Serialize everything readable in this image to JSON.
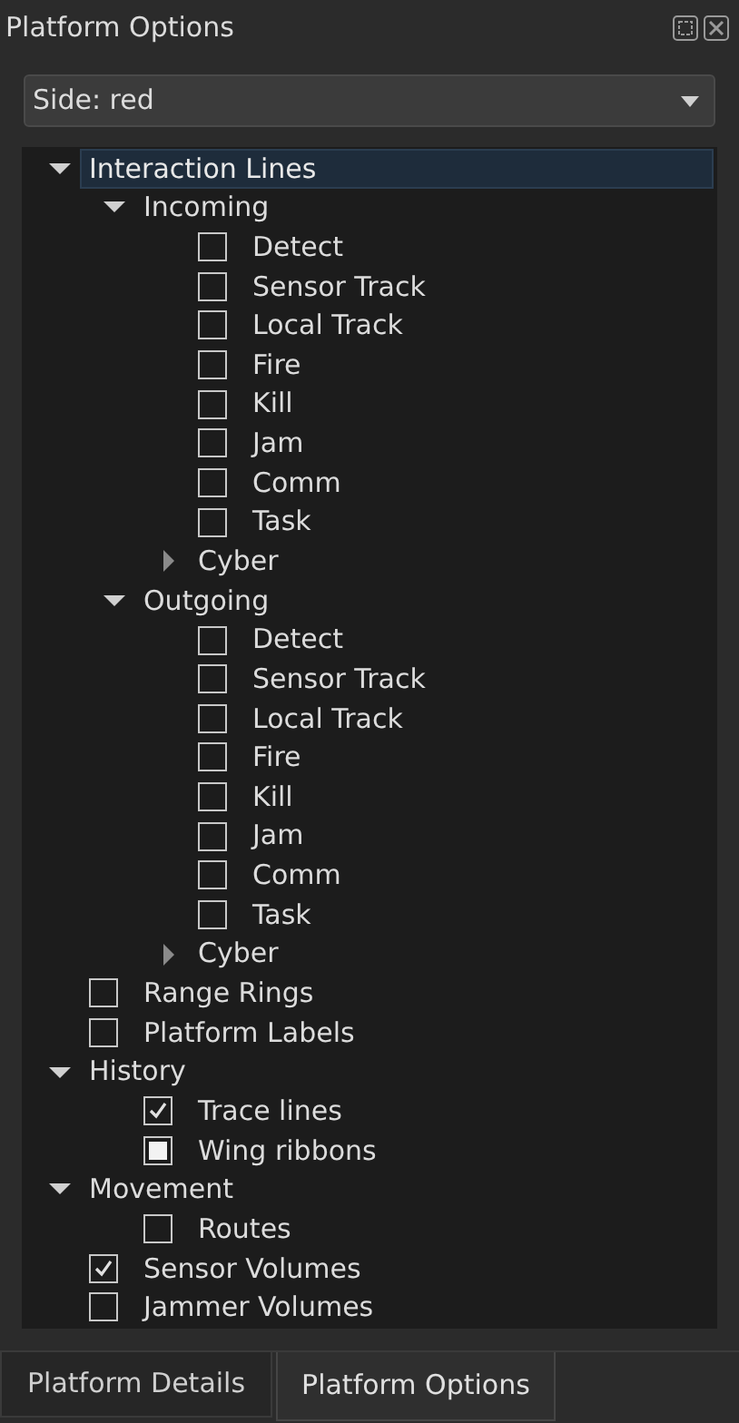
{
  "window": {
    "title": "Platform Options"
  },
  "side_dropdown": {
    "value": "Side: red"
  },
  "tree": [
    {
      "kind": "group",
      "label": "Interaction Lines",
      "selected": true,
      "expanded": true,
      "children": [
        {
          "kind": "group",
          "label": "Incoming",
          "selected": false,
          "expanded": true,
          "children": [
            {
              "kind": "check",
              "label": "Detect",
              "selected": false,
              "checked": false,
              "partial": false
            },
            {
              "kind": "check",
              "label": "Sensor Track",
              "selected": false,
              "checked": false,
              "partial": false
            },
            {
              "kind": "check",
              "label": "Local Track",
              "selected": false,
              "checked": false,
              "partial": false
            },
            {
              "kind": "check",
              "label": "Fire",
              "selected": false,
              "checked": false,
              "partial": false
            },
            {
              "kind": "check",
              "label": "Kill",
              "selected": false,
              "checked": false,
              "partial": false
            },
            {
              "kind": "check",
              "label": "Jam",
              "selected": false,
              "checked": false,
              "partial": false
            },
            {
              "kind": "check",
              "label": "Comm",
              "selected": false,
              "checked": false,
              "partial": false
            },
            {
              "kind": "check",
              "label": "Task",
              "selected": false,
              "checked": false,
              "partial": false
            },
            {
              "kind": "group",
              "label": "Cyber",
              "selected": false,
              "expanded": false
            }
          ]
        },
        {
          "kind": "group",
          "label": "Outgoing",
          "selected": false,
          "expanded": true,
          "children": [
            {
              "kind": "check",
              "label": "Detect",
              "selected": false,
              "checked": false,
              "partial": false
            },
            {
              "kind": "check",
              "label": "Sensor Track",
              "selected": false,
              "checked": false,
              "partial": false
            },
            {
              "kind": "check",
              "label": "Local Track",
              "selected": false,
              "checked": false,
              "partial": false
            },
            {
              "kind": "check",
              "label": "Fire",
              "selected": false,
              "checked": false,
              "partial": false
            },
            {
              "kind": "check",
              "label": "Kill",
              "selected": false,
              "checked": false,
              "partial": false
            },
            {
              "kind": "check",
              "label": "Jam",
              "selected": false,
              "checked": false,
              "partial": false
            },
            {
              "kind": "check",
              "label": "Comm",
              "selected": false,
              "checked": false,
              "partial": false
            },
            {
              "kind": "check",
              "label": "Task",
              "selected": false,
              "checked": false,
              "partial": false
            },
            {
              "kind": "group",
              "label": "Cyber",
              "selected": false,
              "expanded": false
            }
          ]
        }
      ]
    },
    {
      "kind": "check",
      "label": "Range Rings",
      "selected": false,
      "checked": false,
      "partial": false
    },
    {
      "kind": "check",
      "label": "Platform Labels",
      "selected": false,
      "checked": false,
      "partial": false
    },
    {
      "kind": "group",
      "label": "History",
      "selected": false,
      "expanded": true,
      "children": [
        {
          "kind": "check",
          "label": "Trace lines",
          "selected": false,
          "checked": true,
          "partial": false
        },
        {
          "kind": "check",
          "label": "Wing ribbons",
          "selected": false,
          "checked": false,
          "partial": true
        }
      ]
    },
    {
      "kind": "group",
      "label": "Movement",
      "selected": false,
      "expanded": true,
      "children": [
        {
          "kind": "check",
          "label": "Routes",
          "selected": false,
          "checked": false,
          "partial": false
        }
      ]
    },
    {
      "kind": "check",
      "label": "Sensor Volumes",
      "selected": false,
      "checked": true,
      "partial": false
    },
    {
      "kind": "check",
      "label": "Jammer Volumes",
      "selected": false,
      "checked": false,
      "partial": false
    }
  ],
  "tabs": [
    {
      "label": "Platform Details",
      "selected": false
    },
    {
      "label": "Platform Options",
      "selected": true
    }
  ]
}
